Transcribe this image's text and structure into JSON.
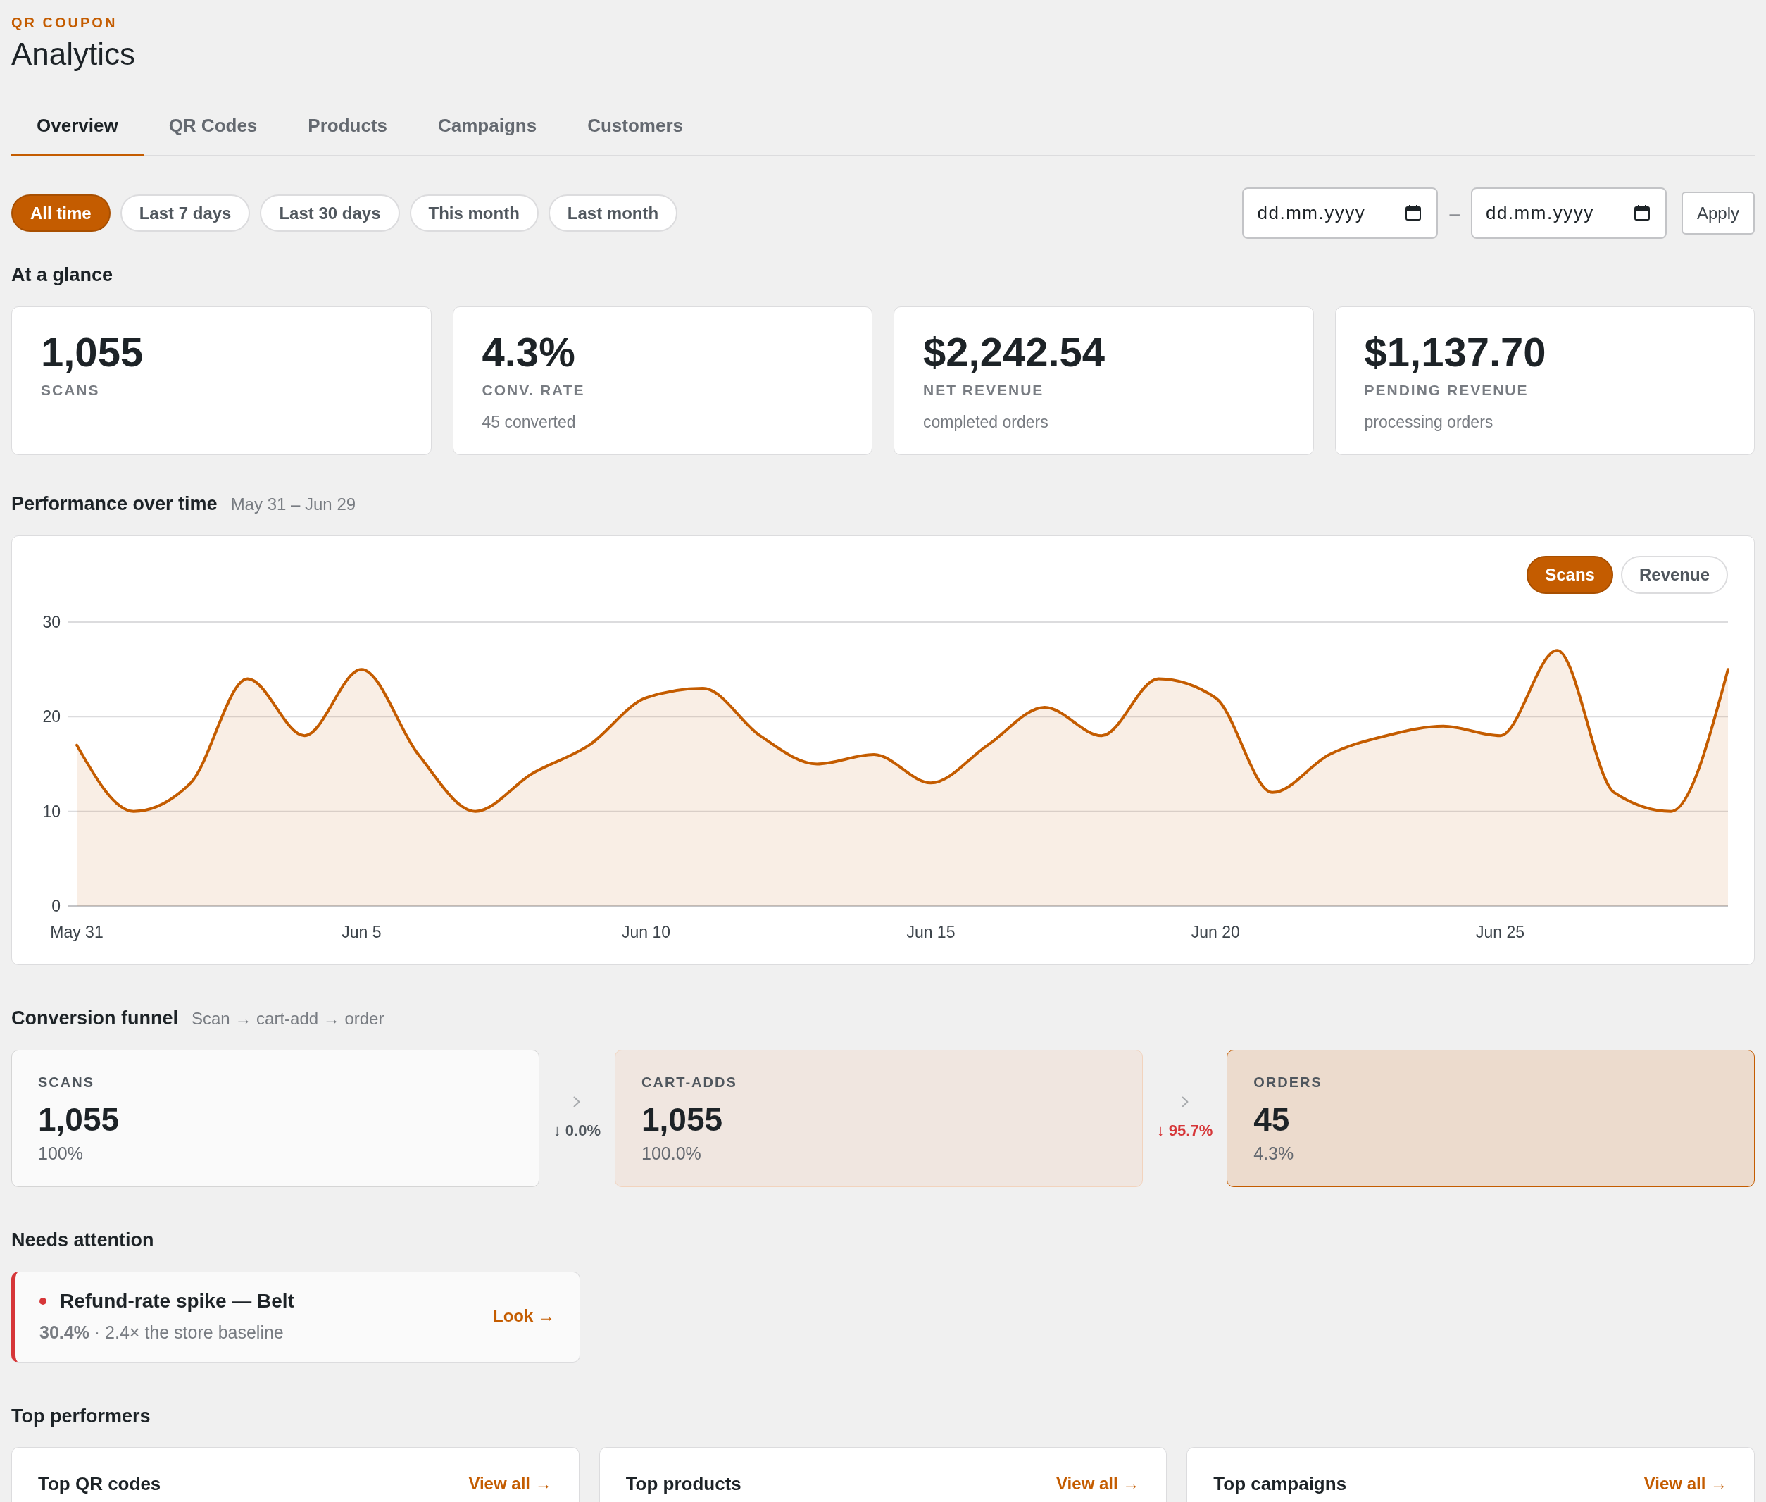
{
  "header": {
    "eyebrow": "QR COUPON",
    "title": "Analytics"
  },
  "tabs": [
    {
      "label": "Overview",
      "selected": true
    },
    {
      "label": "QR Codes",
      "selected": false
    },
    {
      "label": "Products",
      "selected": false
    },
    {
      "label": "Campaigns",
      "selected": false
    },
    {
      "label": "Customers",
      "selected": false
    }
  ],
  "filters": {
    "ranges": [
      {
        "label": "All time",
        "selected": true
      },
      {
        "label": "Last 7 days",
        "selected": false
      },
      {
        "label": "Last 30 days",
        "selected": false
      },
      {
        "label": "This month",
        "selected": false
      },
      {
        "label": "Last month",
        "selected": false
      }
    ],
    "start_date": {
      "placeholder": "dd.mm.yyyy"
    },
    "separator": "–",
    "end_date": {
      "placeholder": "dd.mm.yyyy"
    },
    "apply": "Apply"
  },
  "glance": {
    "title": "At a glance",
    "stats": [
      {
        "value": "1,055",
        "label": "SCANS"
      },
      {
        "value": "4.3%",
        "label": "CONV. RATE",
        "note": "45 converted"
      },
      {
        "value": "$2,242.54",
        "label": "NET REVENUE",
        "note": "completed orders"
      },
      {
        "value": "$1,137.70",
        "label": "PENDING REVENUE",
        "note": "processing orders"
      }
    ]
  },
  "performance": {
    "title": "Performance over time",
    "range": "May 31 – Jun 29",
    "toggles": [
      {
        "label": "Scans",
        "selected": true
      },
      {
        "label": "Revenue",
        "selected": false
      }
    ],
    "chart_data": {
      "type": "area",
      "categories": [
        "May 31",
        null,
        null,
        null,
        null,
        "Jun 5",
        null,
        null,
        null,
        null,
        "Jun 10",
        null,
        null,
        null,
        null,
        "Jun 15",
        null,
        null,
        null,
        null,
        "Jun 20",
        null,
        null,
        null,
        null,
        "Jun 25",
        null,
        null,
        null,
        null
      ],
      "ylim": [
        0,
        30
      ],
      "yticks": [
        0,
        10,
        20,
        30
      ],
      "values": [
        17,
        10,
        13,
        24,
        18,
        25,
        16,
        10,
        14,
        17,
        22,
        23,
        18,
        15,
        16,
        13,
        17,
        21,
        18,
        24,
        22,
        12,
        16,
        18,
        19,
        18,
        27,
        12,
        10,
        25
      ]
    }
  },
  "funnel": {
    "title": "Conversion funnel",
    "subtitle": "Scan → cart-add → order",
    "stages": [
      {
        "label": "SCANS",
        "value": "1,055",
        "share": "100%",
        "kind": "neutral"
      },
      {
        "drop": {
          "text": "↓ 0.0%",
          "alert": false
        },
        "label": "CART-ADDS",
        "value": "1,055",
        "share": "100.0%",
        "kind": "tint"
      },
      {
        "drop": {
          "text": "↓ 95.7%",
          "alert": true
        },
        "label": "ORDERS",
        "value": "45",
        "share": "4.3%",
        "kind": "accent"
      }
    ]
  },
  "attention": {
    "title": "Needs attention",
    "alerts": [
      {
        "title": "Refund-rate spike — Belt",
        "detail": "**30.4%** · 2.4× the store baseline",
        "action": "Look →",
        "color": "#d63638"
      }
    ]
  },
  "top": {
    "title": "Top performers",
    "cards": [
      {
        "title": "Top QR codes",
        "action": "View all →"
      },
      {
        "title": "Top products",
        "action": "View all →"
      },
      {
        "title": "Top campaigns",
        "action": "View all →"
      }
    ]
  }
}
